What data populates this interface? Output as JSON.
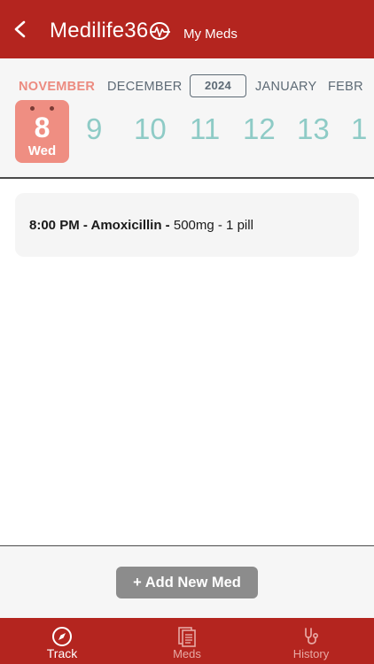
{
  "header": {
    "back_icon": "chevron-left-icon",
    "logo_text": "Medilife36",
    "logo_suffix_icon": "heartbeat-zero-icon",
    "title": "My Meds"
  },
  "calendar": {
    "months": [
      "NOVEMBER",
      "DECEMBER",
      "JANUARY",
      "FEBR"
    ],
    "active_month": "NOVEMBER",
    "year": "2024",
    "selected_day": {
      "number": "8",
      "weekday": "Wed"
    },
    "days": [
      "9",
      "10",
      "11",
      "12",
      "13",
      "1"
    ]
  },
  "med_entry": {
    "time": "8:00 PM",
    "separator1": " - ",
    "name": "Amoxicillin",
    "separator2": " - ",
    "details": "500mg - 1 pill"
  },
  "actions": {
    "add_label": "+ Add New Med"
  },
  "tabs": [
    {
      "label": "Track",
      "icon": "compass-icon",
      "active": true
    },
    {
      "label": "Meds",
      "icon": "documents-icon",
      "active": false
    },
    {
      "label": "History",
      "icon": "stethoscope-icon",
      "active": false
    }
  ],
  "colors": {
    "brand_red": "#b4251f",
    "accent_salmon": "#ef8e82",
    "day_teal": "#8ecbc6",
    "button_gray": "#8c8c8c"
  }
}
